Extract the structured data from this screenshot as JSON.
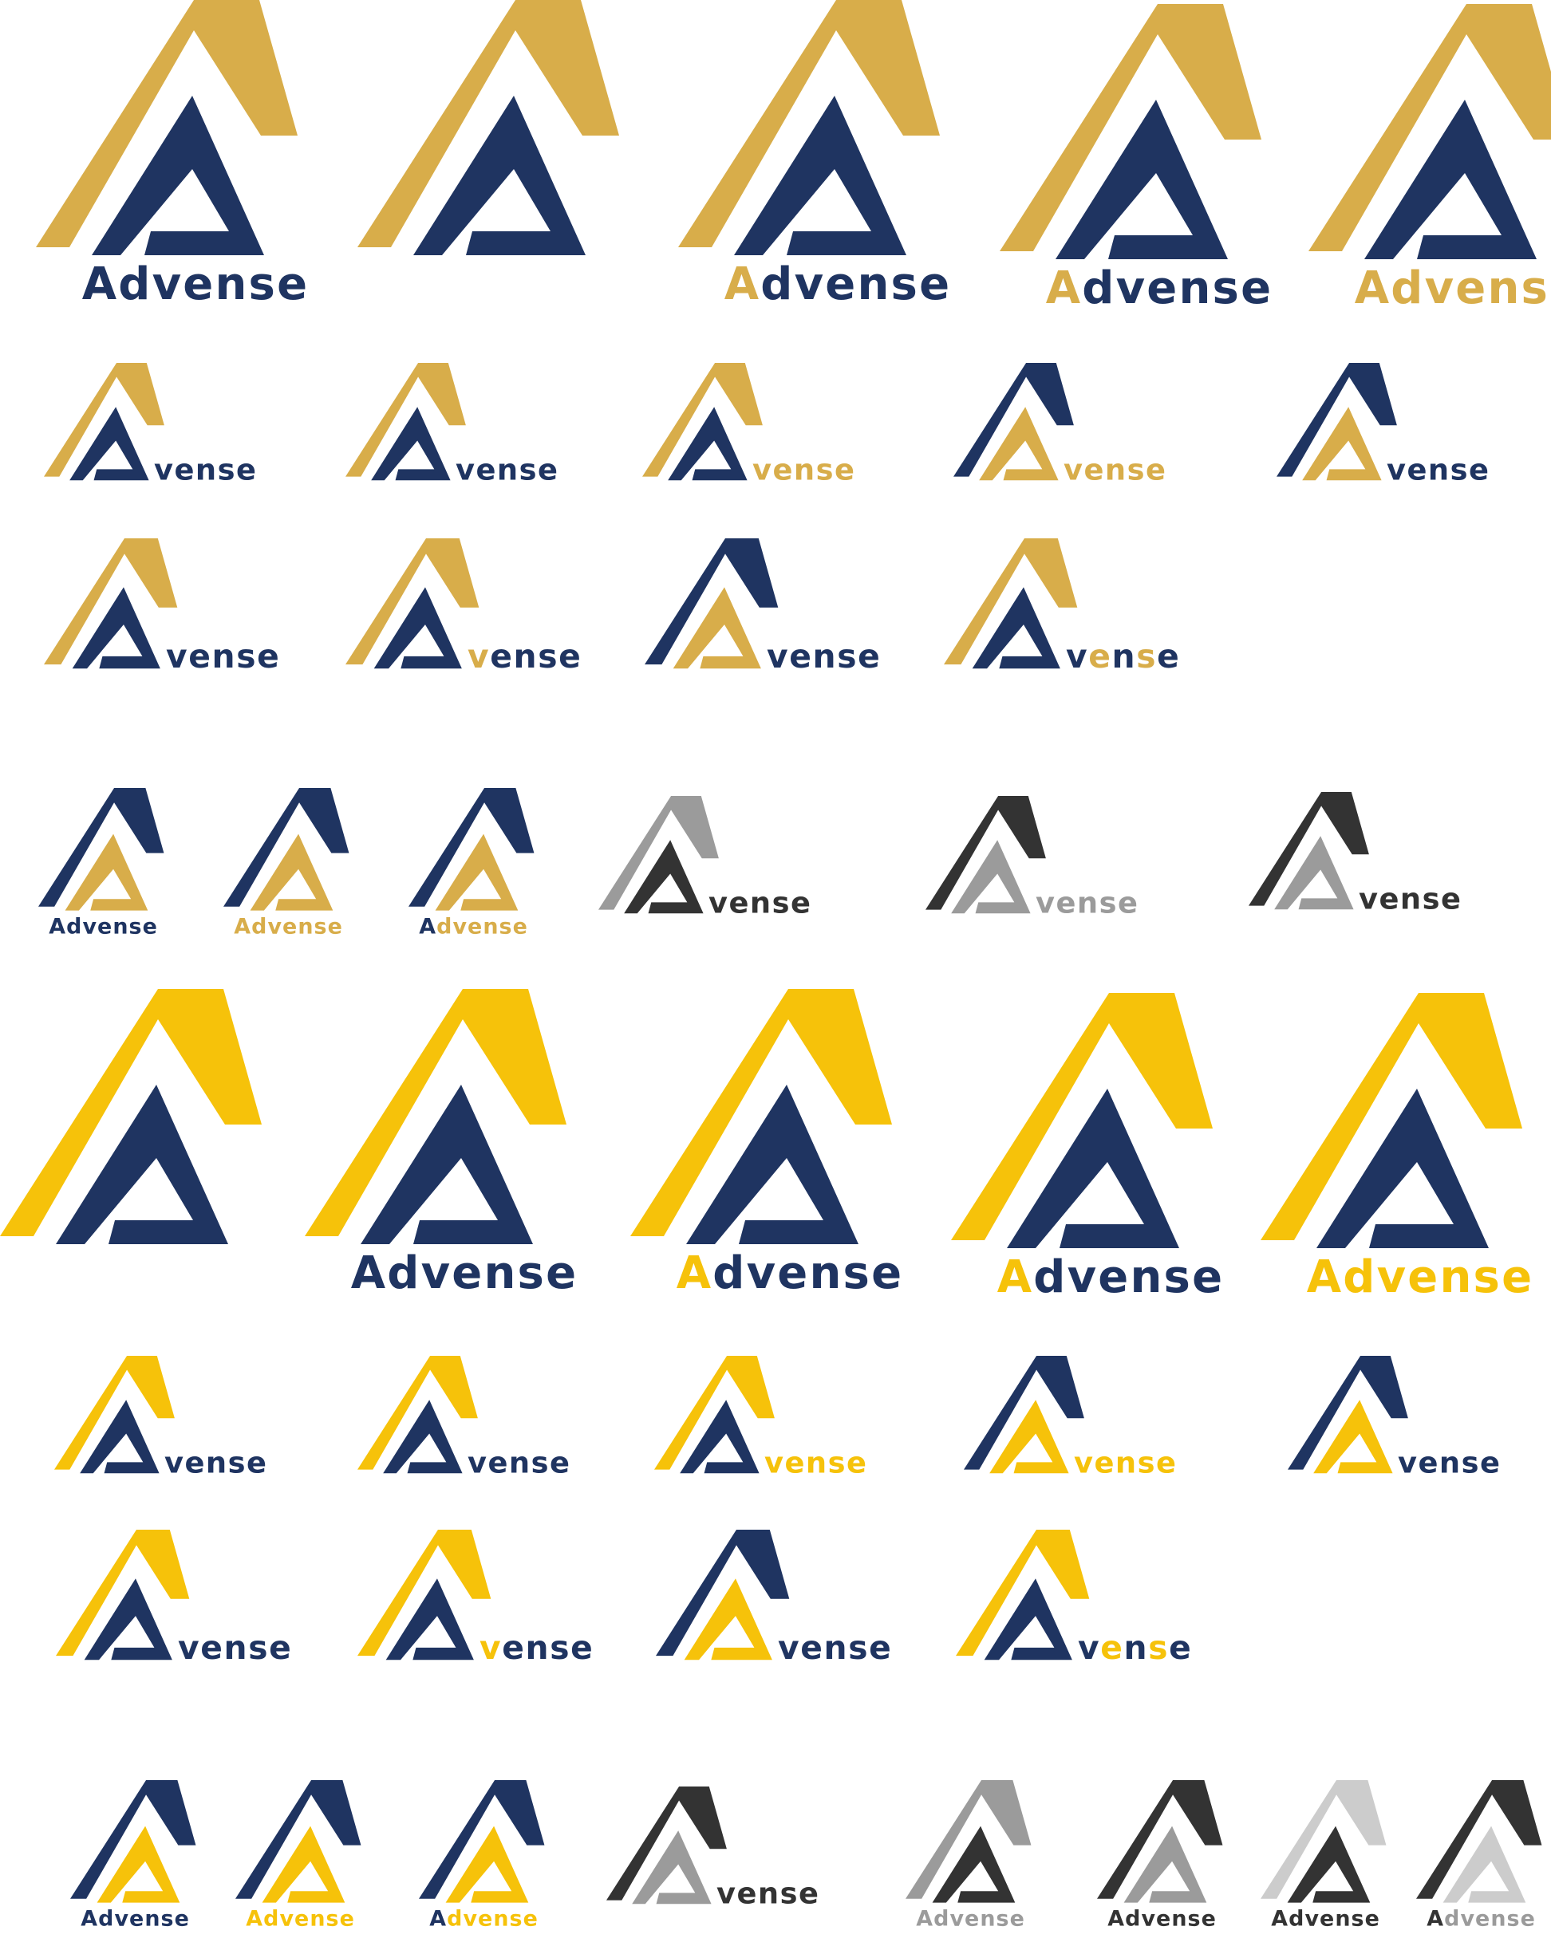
{
  "word": "Advense",
  "tail": "vense",
  "colors": {
    "navy": "#1f3461",
    "gold": "#d8ad4a",
    "yellow": "#f6c20a",
    "gray": "#9b9b9b",
    "dark": "#333333",
    "light": "#cccccc",
    "background": "#ffffff"
  },
  "logos": [
    {
      "layout": "stack",
      "outer": "gold",
      "inner": "navy",
      "text": "navy",
      "first": "navy"
    },
    {
      "layout": "mark",
      "outer": "gold",
      "inner": "navy"
    },
    {
      "layout": "stack",
      "outer": "gold",
      "inner": "navy",
      "text": "navy",
      "first": "gold"
    },
    {
      "layout": "stack",
      "outer": "gold",
      "inner": "navy",
      "text": "navy",
      "first": "gold"
    },
    {
      "layout": "stack",
      "outer": "gold",
      "inner": "navy",
      "text": "gold",
      "first": "gold"
    },
    {
      "layout": "inline",
      "outer": "gold",
      "inner": "navy",
      "text": "navy"
    },
    {
      "layout": "inline",
      "outer": "gold",
      "inner": "navy",
      "text": "navy"
    },
    {
      "layout": "inline",
      "outer": "gold",
      "inner": "navy",
      "text": "gold"
    },
    {
      "layout": "inline",
      "outer": "navy",
      "inner": "gold",
      "text": "gold"
    },
    {
      "layout": "inline",
      "outer": "navy",
      "inner": "gold",
      "text": "navy"
    },
    {
      "layout": "inline",
      "outer": "gold",
      "inner": "navy",
      "text": "navy"
    },
    {
      "layout": "inline",
      "outer": "gold",
      "inner": "navy",
      "text": "navy",
      "accent": {
        "0": "gold"
      }
    },
    {
      "layout": "inline",
      "outer": "navy",
      "inner": "gold",
      "text": "navy"
    },
    {
      "layout": "inline",
      "outer": "gold",
      "inner": "navy",
      "text": "navy",
      "accent": {
        "1": "gold",
        "3": "gold"
      }
    },
    {
      "layout": "small",
      "outer": "navy",
      "inner": "gold",
      "text": "navy",
      "first": "navy"
    },
    {
      "layout": "small",
      "outer": "navy",
      "inner": "gold",
      "text": "gold",
      "first": "gold"
    },
    {
      "layout": "small",
      "outer": "navy",
      "inner": "gold",
      "text": "gold",
      "first": "navy"
    },
    {
      "layout": "inline",
      "outer": "gray",
      "inner": "dark",
      "text": "dark"
    },
    {
      "layout": "inline",
      "outer": "dark",
      "inner": "gray",
      "text": "gray"
    },
    {
      "layout": "inline",
      "outer": "dark",
      "inner": "gray",
      "text": "dark"
    },
    {
      "layout": "mark",
      "outer": "yellow",
      "inner": "navy"
    },
    {
      "layout": "stack",
      "outer": "yellow",
      "inner": "navy",
      "text": "navy",
      "first": "navy"
    },
    {
      "layout": "stack",
      "outer": "yellow",
      "inner": "navy",
      "text": "navy",
      "first": "yellow"
    },
    {
      "layout": "stack",
      "outer": "yellow",
      "inner": "navy",
      "text": "navy",
      "first": "yellow"
    },
    {
      "layout": "stack",
      "outer": "yellow",
      "inner": "navy",
      "text": "yellow",
      "first": "yellow"
    },
    {
      "layout": "inline",
      "outer": "yellow",
      "inner": "navy",
      "text": "navy"
    },
    {
      "layout": "inline",
      "outer": "yellow",
      "inner": "navy",
      "text": "navy"
    },
    {
      "layout": "inline",
      "outer": "yellow",
      "inner": "navy",
      "text": "yellow"
    },
    {
      "layout": "inline",
      "outer": "navy",
      "inner": "yellow",
      "text": "yellow"
    },
    {
      "layout": "inline",
      "outer": "navy",
      "inner": "yellow",
      "text": "navy"
    },
    {
      "layout": "inline",
      "outer": "yellow",
      "inner": "navy",
      "text": "navy"
    },
    {
      "layout": "inline",
      "outer": "yellow",
      "inner": "navy",
      "text": "navy",
      "accent": {
        "0": "yellow"
      }
    },
    {
      "layout": "inline",
      "outer": "navy",
      "inner": "yellow",
      "text": "navy"
    },
    {
      "layout": "inline",
      "outer": "yellow",
      "inner": "navy",
      "text": "navy",
      "accent": {
        "1": "yellow",
        "3": "yellow"
      }
    },
    {
      "layout": "small",
      "outer": "navy",
      "inner": "yellow",
      "text": "navy",
      "first": "navy"
    },
    {
      "layout": "small",
      "outer": "navy",
      "inner": "yellow",
      "text": "yellow",
      "first": "yellow"
    },
    {
      "layout": "small",
      "outer": "navy",
      "inner": "yellow",
      "text": "yellow",
      "first": "navy"
    },
    {
      "layout": "inline",
      "outer": "dark",
      "inner": "gray",
      "text": "dark"
    },
    {
      "layout": "small",
      "outer": "gray",
      "inner": "dark",
      "text": "gray",
      "first": "gray"
    },
    {
      "layout": "small",
      "outer": "dark",
      "inner": "gray",
      "text": "dark",
      "first": "dark"
    },
    {
      "layout": "small",
      "outer": "light",
      "inner": "dark",
      "text": "dark",
      "first": "dark"
    },
    {
      "layout": "small",
      "outer": "dark",
      "inner": "light",
      "text": "gray",
      "first": "dark"
    }
  ]
}
